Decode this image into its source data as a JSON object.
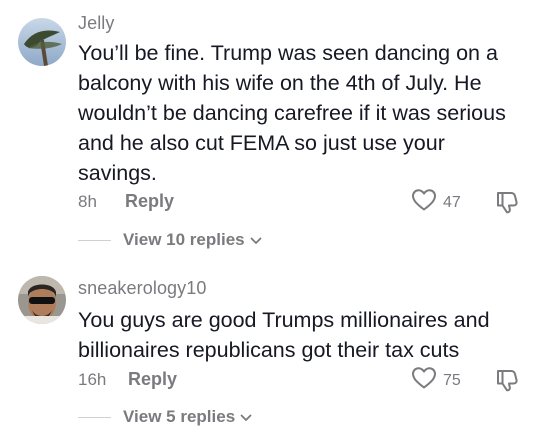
{
  "comments": [
    {
      "username": "Jelly",
      "text": "You’ll be fine. Trump was seen dancing on a balcony with his wife on the 4th of July. He wouldn’t be dancing carefree if it was serious and he also cut FEMA so just use your savings.",
      "time": "8h",
      "reply_label": "Reply",
      "likes": "47",
      "view_replies": "View 10 replies"
    },
    {
      "username": "sneakerology10",
      "text": "You guys are good Trumps millionaires and billionaires republicans got their tax cuts",
      "time": "16h",
      "reply_label": "Reply",
      "likes": "75",
      "view_replies": "View 5 replies"
    }
  ],
  "icons": {
    "like": "heart-outline-icon",
    "dislike": "thumbs-down-outline-icon",
    "expand": "chevron-down-icon"
  },
  "colors": {
    "text": "#161823",
    "secondary": "#7a7a7f",
    "divider": "#d0d0d4"
  }
}
